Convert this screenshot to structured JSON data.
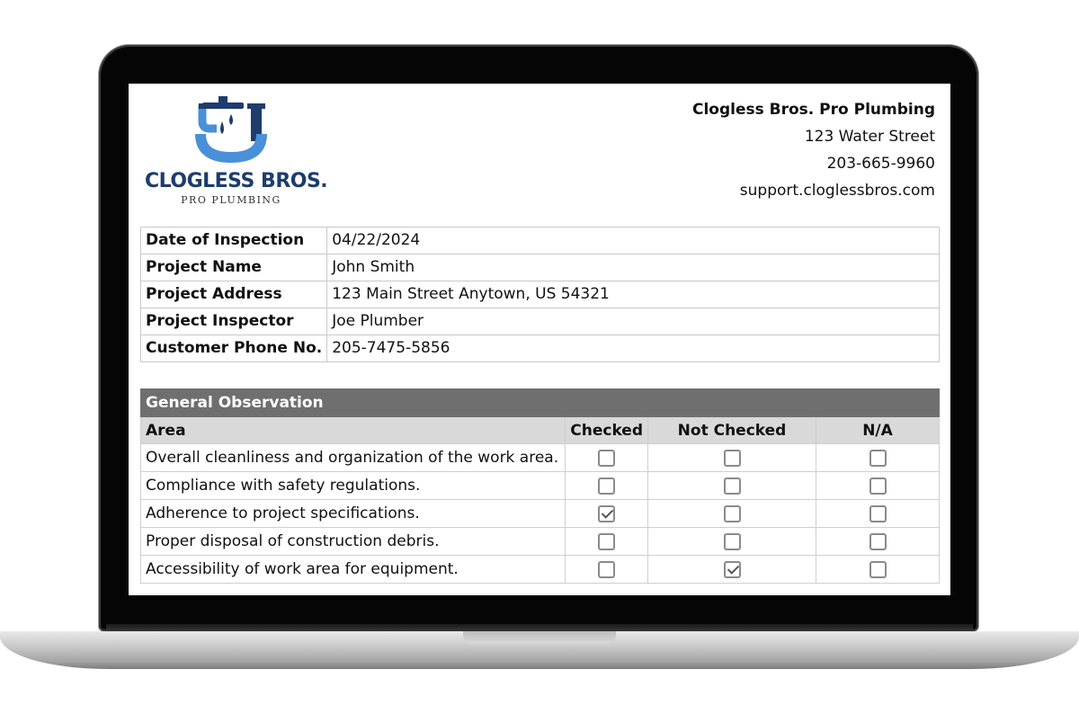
{
  "company": {
    "logo_brand": "CLOGLESS BROS.",
    "logo_sub": "PRO PLUMBING",
    "name": "Clogless Bros. Pro Plumbing",
    "street": "123 Water Street",
    "phone": "203-665-9960",
    "email": "support.cloglessbros.com"
  },
  "colors": {
    "brand_blue": "#1d3d6b",
    "logo_light_blue": "#4a90d9",
    "section_header": "#6f6f6f",
    "column_header": "#d9d9d9"
  },
  "info": [
    {
      "label": "Date of Inspection",
      "value": "04/22/2024"
    },
    {
      "label": "Project Name",
      "value": "John Smith"
    },
    {
      "label": "Project Address",
      "value": "123 Main Street Anytown, US 54321"
    },
    {
      "label": "Project Inspector",
      "value": "Joe Plumber"
    },
    {
      "label": "Customer Phone No.",
      "value": "205-7475-5856"
    }
  ],
  "observation": {
    "section_title": "General Observation",
    "columns": [
      "Area",
      "Checked",
      "Not Checked",
      "N/A"
    ],
    "rows": [
      {
        "area": "Overall cleanliness and organization of the work area.",
        "status": "none"
      },
      {
        "area": "Compliance with safety regulations.",
        "status": "none"
      },
      {
        "area": "Adherence to project specifications.",
        "status": "checked"
      },
      {
        "area": "Proper disposal of construction debris.",
        "status": "none"
      },
      {
        "area": "Accessibility of work area for equipment.",
        "status": "not_checked"
      }
    ]
  }
}
